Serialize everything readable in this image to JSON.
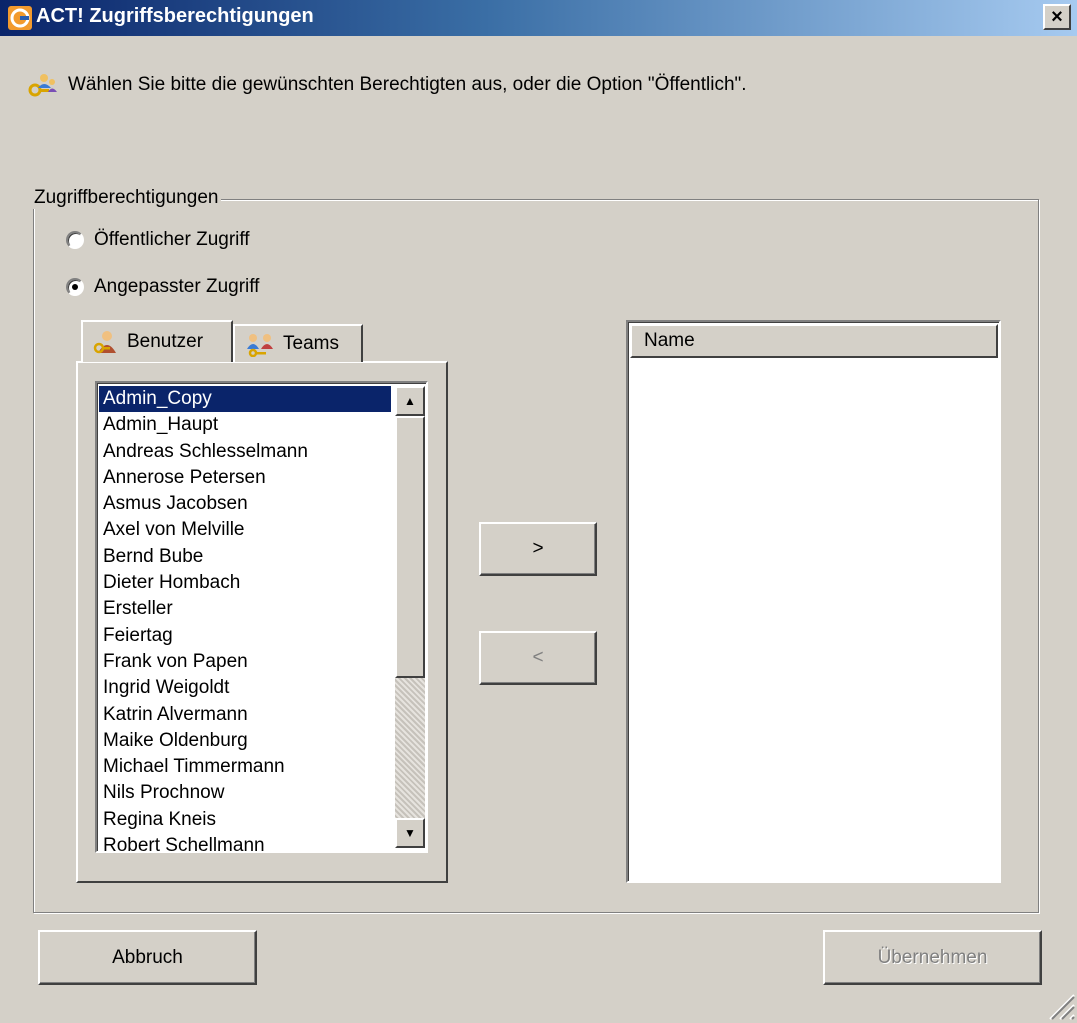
{
  "window": {
    "title": "ACT! Zugriffsberechtigungen",
    "close_label": "×"
  },
  "hint": "Wählen Sie bitte die gewünschten Berechtigten aus, oder die Option \"Öffentlich\".",
  "group": {
    "legend": "Zugriffberechtigungen",
    "radio_public": "Öffentlicher Zugriff",
    "radio_custom": "Angepasster Zugriff",
    "selected_option": "Angepasster Zugriff"
  },
  "tabs": {
    "users": "Benutzer",
    "teams": "Teams",
    "active": "Benutzer"
  },
  "users": {
    "selected": "Admin_Copy",
    "items": [
      "Admin_Copy",
      "Admin_Haupt",
      "Andreas Schlesselmann",
      "Annerose Petersen",
      "Asmus Jacobsen",
      "Axel von Melville",
      "Bernd Bube",
      "Dieter Hombach",
      "Ersteller",
      "Feiertag",
      "Frank von Papen",
      "Ingrid Weigoldt",
      "Katrin Alvermann",
      "Maike Oldenburg",
      "Michael Timmermann",
      "Nils Prochnow",
      "Regina Kneis",
      "Robert Schellmann"
    ]
  },
  "move": {
    "add_label": ">",
    "remove_label": "<"
  },
  "selected_list": {
    "column_name": "Name",
    "items": []
  },
  "footer": {
    "cancel_label": "Abbruch",
    "apply_label": "Übernehmen"
  },
  "colors": {
    "face": "#d4d0c8",
    "selection": "#0a246a",
    "title_start": "#0a246a",
    "title_end": "#a6caf0"
  }
}
